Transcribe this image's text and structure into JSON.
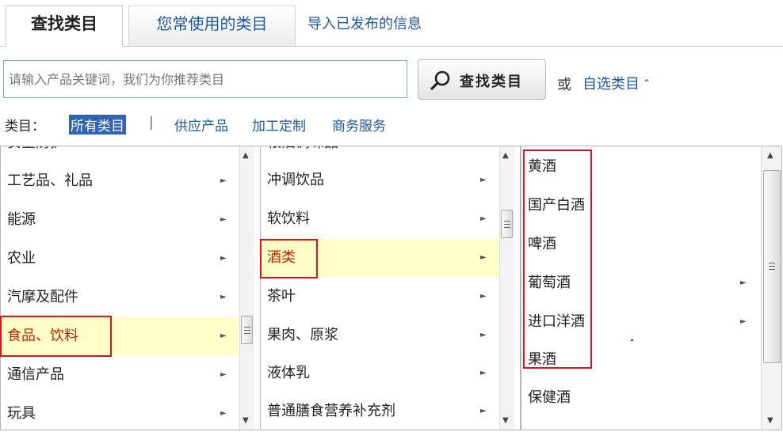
{
  "tabs": {
    "active": "查找类目",
    "frequent": "您常使用的类目",
    "import": "导入已发布的信息"
  },
  "search": {
    "placeholder": "请输入产品关键词，我们为你推荐类目",
    "button_label": "查找类目",
    "or_text": "或",
    "custom_link": "自选类目",
    "custom_link_icon": "double-chevron-up-icon"
  },
  "filter": {
    "label": "类目：",
    "all": "所有类目",
    "separator": "|",
    "items": [
      "供应产品",
      "加工定制",
      "商务服务"
    ]
  },
  "colors": {
    "link": "#1c56a6",
    "selected_bg": "#ffffc7",
    "selected_text": "#cc1f00",
    "annotation": "#e01020",
    "filter_active_bg": "#2f63b5"
  },
  "panel1": {
    "partial_top": "安全防护",
    "items": [
      {
        "label": "工艺品、礼品",
        "has_children": true
      },
      {
        "label": "能源",
        "has_children": true
      },
      {
        "label": "农业",
        "has_children": true
      },
      {
        "label": "汽摩及配件",
        "has_children": true
      },
      {
        "label": "食品、饮料",
        "has_children": true,
        "selected": true
      },
      {
        "label": "通信产品",
        "has_children": true
      },
      {
        "label": "玩具",
        "has_children": true
      }
    ]
  },
  "panel2": {
    "partial_top": "粮油调味品",
    "items": [
      {
        "label": "冲调饮品",
        "has_children": true
      },
      {
        "label": "软饮料",
        "has_children": true
      },
      {
        "label": "酒类",
        "has_children": true,
        "selected": true
      },
      {
        "label": "茶叶",
        "has_children": true
      },
      {
        "label": "果肉、原浆",
        "has_children": true
      },
      {
        "label": "液体乳",
        "has_children": true
      },
      {
        "label": "普通膳食营养补充剂",
        "has_children": true
      }
    ]
  },
  "panel3": {
    "items": [
      {
        "label": "黄酒",
        "has_children": false
      },
      {
        "label": "国产白酒",
        "has_children": false
      },
      {
        "label": "啤酒",
        "has_children": false
      },
      {
        "label": "葡萄酒",
        "has_children": true
      },
      {
        "label": "进口洋酒",
        "has_children": true
      },
      {
        "label": "果酒",
        "has_children": false
      },
      {
        "label": "保健酒",
        "has_children": false
      }
    ]
  },
  "icons": {
    "search": "search-icon",
    "row_arrow": "triangle-right-icon",
    "scroll_up": "triangle-up-icon",
    "scroll_down": "triangle-down-icon"
  }
}
